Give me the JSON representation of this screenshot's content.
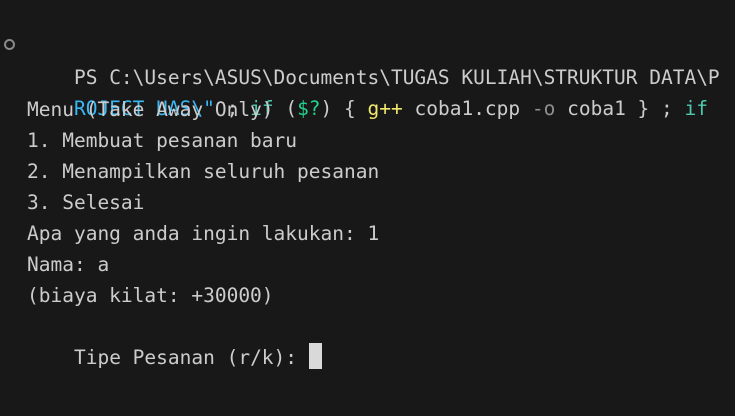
{
  "terminal": {
    "prompt_marker": "circle-icon",
    "lines": [
      "PS C:\\Users\\ASUS\\Documents\\TUGAS KULIAH\\STRUKTUR DATA\\P",
      "Menu (Take Away Only)",
      "1. Membuat pesanan baru",
      "2. Menampilkan seluruh pesanan",
      "3. Selesai",
      "Apa yang anda ingin lakukan: 1",
      "Nama: a",
      "(biaya kilat: +30000)",
      "Tipe Pesanan (r/k): r"
    ],
    "command_line": {
      "part1": "ROJECT UAS\\\"",
      "part2": " ; ",
      "part3": "if",
      "part4": " (",
      "part5": "$?",
      "part6": ") { ",
      "part7": "g++",
      "part8": " coba1.cpp ",
      "part9": "-o",
      "part10": " coba1 } ; ",
      "part11": "if"
    }
  }
}
